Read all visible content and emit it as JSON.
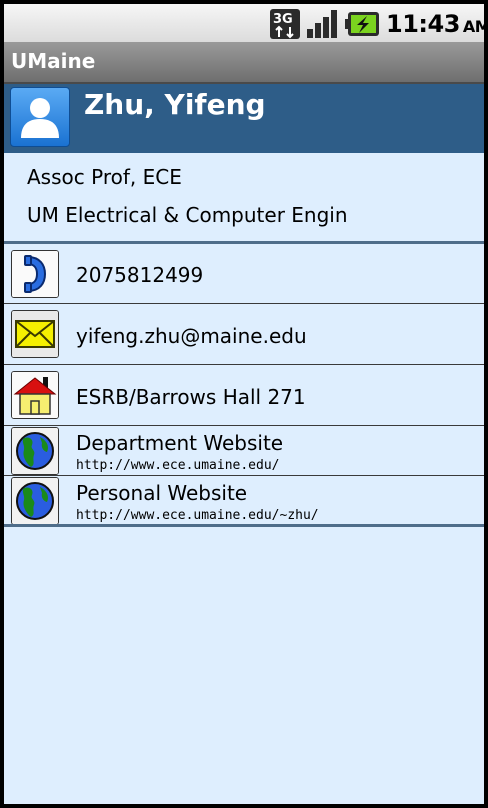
{
  "status_bar": {
    "network": "3G",
    "time": "11:43",
    "ampm": "AM"
  },
  "app": {
    "title": "UMaine"
  },
  "contact": {
    "name": "Zhu, Yifeng",
    "title": "Assoc Prof, ECE",
    "department": "UM Electrical & Computer Engin"
  },
  "details": {
    "phone": "2075812499",
    "email": "yifeng.zhu@maine.edu",
    "office": "ESRB/Barrows Hall 271",
    "dept_site_label": "Department Website",
    "dept_site_url": "http://www.ece.umaine.edu/",
    "personal_site_label": "Personal Website",
    "personal_site_url": "http://www.ece.umaine.edu/~zhu/"
  },
  "colors": {
    "background": "#deeefe",
    "header": "#2e5d88",
    "title_bar": "#7f7f7f"
  }
}
